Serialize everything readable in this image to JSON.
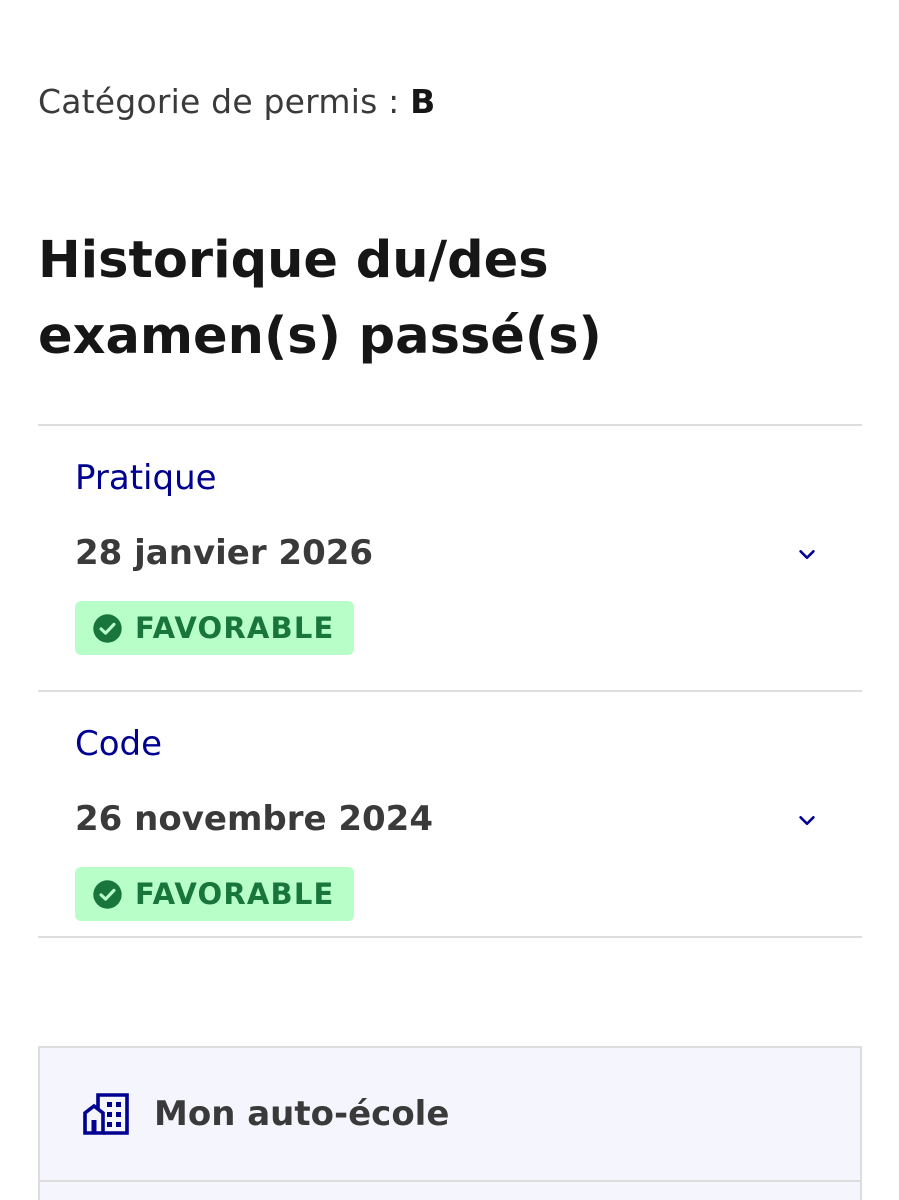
{
  "permit": {
    "label": "Catégorie de permis :",
    "value": "B"
  },
  "history": {
    "title": "Historique du/des examen(s) passé(s)",
    "exams": [
      {
        "type": "Pratique",
        "date": "28 janvier 2026",
        "result": "FAVORABLE",
        "expand_icon": "chevron-down-icon",
        "result_icon": "check-circle-icon"
      },
      {
        "type": "Code",
        "date": "26 novembre 2024",
        "result": "FAVORABLE",
        "expand_icon": "chevron-down-icon",
        "result_icon": "check-circle-icon"
      }
    ]
  },
  "driving_school": {
    "title": "Mon auto-école",
    "icon": "building-icon"
  },
  "colors": {
    "accent_blue": "#000091",
    "success_bg": "#b8fec9",
    "success_text": "#18753c",
    "card_bg": "#f5f5fe",
    "divider": "#dddddd"
  }
}
